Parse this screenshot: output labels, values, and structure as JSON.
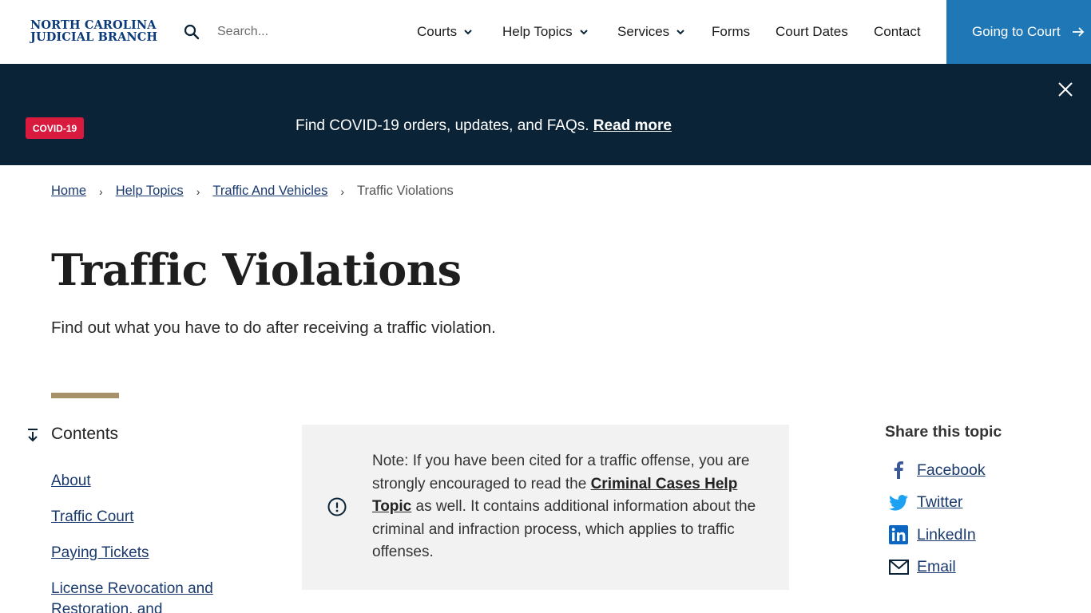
{
  "header": {
    "logo_line1": "NORTH CAROLINA",
    "logo_line2": "JUDICIAL BRANCH",
    "search_placeholder": "Search...",
    "nav": [
      {
        "label": "Courts",
        "has_dropdown": true
      },
      {
        "label": "Help Topics",
        "has_dropdown": true
      },
      {
        "label": "Services",
        "has_dropdown": true
      },
      {
        "label": "Forms",
        "has_dropdown": false
      },
      {
        "label": "Court Dates",
        "has_dropdown": false
      },
      {
        "label": "Contact",
        "has_dropdown": false
      }
    ],
    "cta_label": "Going to Court",
    "cta_color": "#1f78b5"
  },
  "banner": {
    "badge": "COVID-19",
    "text": "Find COVID-19 orders, updates, and FAQs.",
    "link": "Read more",
    "badge_color": "#d91a3f",
    "background": "#0a2336"
  },
  "breadcrumb": {
    "items": [
      "Home",
      "Help Topics",
      "Traffic And Vehicles"
    ],
    "current": "Traffic Violations"
  },
  "page": {
    "title": "Traffic Violations",
    "subtitle": "Find out what you have to do after receiving a traffic violation."
  },
  "contents": {
    "title": "Contents",
    "items": [
      "About",
      "Traffic Court",
      "Paying Tickets",
      "License Revocation and Restoration, and"
    ]
  },
  "note": {
    "text_before": "Note: If you have been cited for a traffic offense, you are strongly encouraged to read the ",
    "link": "Criminal Cases Help Topic",
    "text_after": " as well. It contains additional information about the criminal and infraction process, which applies to traffic offenses."
  },
  "share": {
    "title": "Share this topic",
    "items": [
      {
        "label": "Facebook",
        "icon": "facebook-icon"
      },
      {
        "label": "Twitter",
        "icon": "twitter-icon"
      },
      {
        "label": "LinkedIn",
        "icon": "linkedin-icon"
      },
      {
        "label": "Email",
        "icon": "email-icon"
      }
    ]
  }
}
